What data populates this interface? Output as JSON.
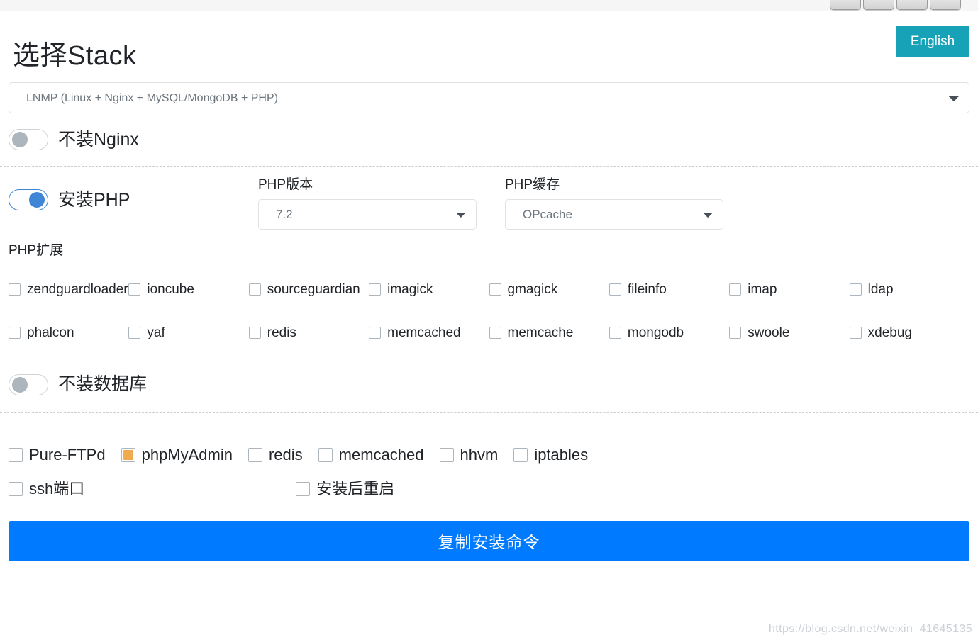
{
  "window": {
    "chrome_buttons": [
      "window-button-1",
      "window-button-2",
      "window-button-3",
      "window-button-4"
    ]
  },
  "header": {
    "title": "选择Stack",
    "language_button": "English"
  },
  "stack": {
    "selected": "LNMP (Linux + Nginx + MySQL/MongoDB + PHP)",
    "options": [
      "LNMP (Linux + Nginx + MySQL/MongoDB + PHP)"
    ]
  },
  "nginx": {
    "toggle_label": "不装Nginx",
    "toggle_on": false
  },
  "php": {
    "toggle_label": "安装PHP",
    "toggle_on": true,
    "version_label": "PHP版本",
    "version_selected": "7.2",
    "cache_label": "PHP缓存",
    "cache_selected": "OPcache",
    "extensions_label": "PHP扩展",
    "extensions": [
      [
        {
          "label": "zendguardloader",
          "checked": false
        },
        {
          "label": "ioncube",
          "checked": false
        },
        {
          "label": "sourceguardian",
          "checked": false
        },
        {
          "label": "imagick",
          "checked": false
        },
        {
          "label": "gmagick",
          "checked": false
        },
        {
          "label": "fileinfo",
          "checked": false
        },
        {
          "label": "imap",
          "checked": false
        },
        {
          "label": "ldap",
          "checked": false
        }
      ],
      [
        {
          "label": "phalcon",
          "checked": false
        },
        {
          "label": "yaf",
          "checked": false
        },
        {
          "label": "redis",
          "checked": false
        },
        {
          "label": "memcached",
          "checked": false
        },
        {
          "label": "memcache",
          "checked": false
        },
        {
          "label": "mongodb",
          "checked": false
        },
        {
          "label": "swoole",
          "checked": false
        },
        {
          "label": "xdebug",
          "checked": false
        }
      ]
    ]
  },
  "database": {
    "toggle_label": "不装数据库",
    "toggle_on": false
  },
  "services": [
    {
      "label": "Pure-FTPd",
      "checked": false
    },
    {
      "label": "phpMyAdmin",
      "checked": true
    },
    {
      "label": "redis",
      "checked": false
    },
    {
      "label": "memcached",
      "checked": false
    },
    {
      "label": "hhvm",
      "checked": false
    },
    {
      "label": "iptables",
      "checked": false
    }
  ],
  "options_row": [
    {
      "label": "ssh端口",
      "checked": false
    },
    {
      "label": "安装后重启",
      "checked": false
    }
  ],
  "submit": {
    "label": "复制安装命令"
  },
  "watermark": "https://blog.csdn.net/weixin_41645135",
  "colors": {
    "accent_blue": "#007bff",
    "teal": "#17a2b8",
    "toggle_on": "#3f87d6",
    "toggle_off": "#adb5bd",
    "checkbox_checked": "#efab4e"
  }
}
